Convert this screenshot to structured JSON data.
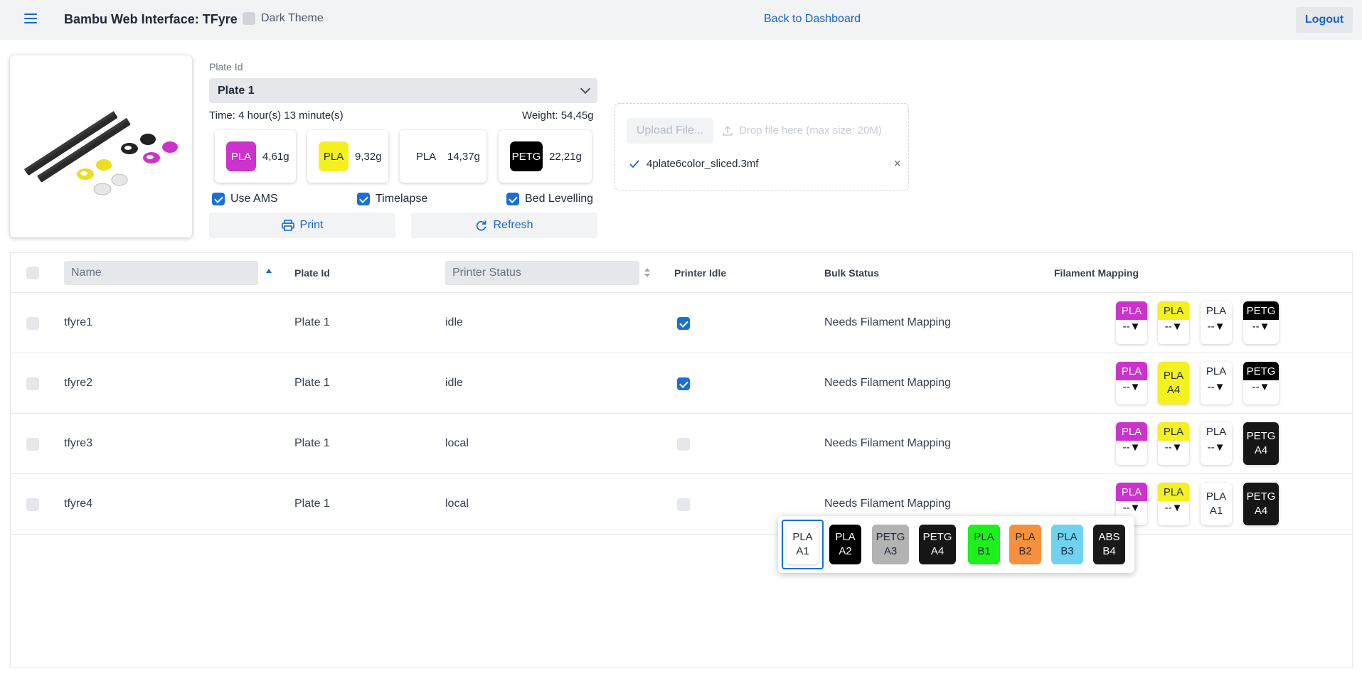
{
  "header": {
    "title": "Bambu Web Interface: TFyre",
    "dark_theme_label": "Dark Theme",
    "back_link": "Back to Dashboard",
    "logout": "Logout",
    "menu_icon": "hamburger-menu-icon"
  },
  "plate": {
    "label": "Plate Id",
    "selected": "Plate 1",
    "time": "Time: 4 hour(s) 13 minute(s)",
    "weight": "Weight: 54,45g",
    "filaments": [
      {
        "type": "PLA",
        "weight": "4,61g",
        "color": "#cc33cc",
        "text_color": "#ffffff"
      },
      {
        "type": "PLA",
        "weight": "9,32g",
        "color": "#f5f020",
        "text_color": "#1f2937"
      },
      {
        "type": "PLA",
        "weight": "14,37g",
        "color": "#ffffff",
        "text_color": "#1f2937"
      },
      {
        "type": "PETG",
        "weight": "22,21g",
        "color": "#000000",
        "text_color": "#ffffff"
      }
    ],
    "options": {
      "use_ams": "Use AMS",
      "timelapse": "Timelapse",
      "bed_levelling": "Bed Levelling"
    },
    "print_btn": "Print",
    "refresh_btn": "Refresh"
  },
  "upload": {
    "button": "Upload File...",
    "drop_hint": "Drop file here (max size: 20M)",
    "file_name": "4plate6color_sliced.3mf"
  },
  "table": {
    "columns": {
      "name": "Name",
      "plate_id": "Plate Id",
      "printer_status": "Printer Status",
      "printer_idle": "Printer Idle",
      "bulk_status": "Bulk Status",
      "filament_mapping": "Filament Mapping"
    },
    "rows": [
      {
        "name": "tfyre1",
        "plate": "Plate 1",
        "status": "idle",
        "idle": true,
        "bulk": "Needs Filament Mapping",
        "map": [
          "--▼",
          "--▼",
          "--▼",
          "--▼"
        ]
      },
      {
        "name": "tfyre2",
        "plate": "Plate 1",
        "status": "idle",
        "idle": true,
        "bulk": "Needs Filament Mapping",
        "map": [
          "--▼",
          "A4",
          "--▼",
          "--▼"
        ]
      },
      {
        "name": "tfyre3",
        "plate": "Plate 1",
        "status": "local",
        "idle": false,
        "bulk": "Needs Filament Mapping",
        "map": [
          "--▼",
          "--▼",
          "--▼",
          "A4"
        ]
      },
      {
        "name": "tfyre4",
        "plate": "Plate 1",
        "status": "local",
        "idle": false,
        "bulk": "Needs Filament Mapping",
        "map": [
          "--▼",
          "--▼",
          "A1",
          "A4"
        ]
      }
    ]
  },
  "popup": {
    "options": [
      {
        "type": "PLA",
        "slot": "A1",
        "color": "#ffffff",
        "text_color": "#1f2937"
      },
      {
        "type": "PLA",
        "slot": "A2",
        "color": "#000000",
        "text_color": "#ffffff"
      },
      {
        "type": "PETG",
        "slot": "A3",
        "color": "#b3b3b3",
        "text_color": "#1f2937"
      },
      {
        "type": "PETG",
        "slot": "A4",
        "color": "#161616",
        "text_color": "#ffffff"
      },
      {
        "type": "PLA",
        "slot": "B1",
        "color": "#1ef01e",
        "text_color": "#1f2937"
      },
      {
        "type": "PLA",
        "slot": "B2",
        "color": "#f5913d",
        "text_color": "#1f2937"
      },
      {
        "type": "PLA",
        "slot": "B3",
        "color": "#6fd3ef",
        "text_color": "#1f2937"
      },
      {
        "type": "ABS",
        "slot": "B4",
        "color": "#1a1a1a",
        "text_color": "#ffffff"
      }
    ]
  }
}
